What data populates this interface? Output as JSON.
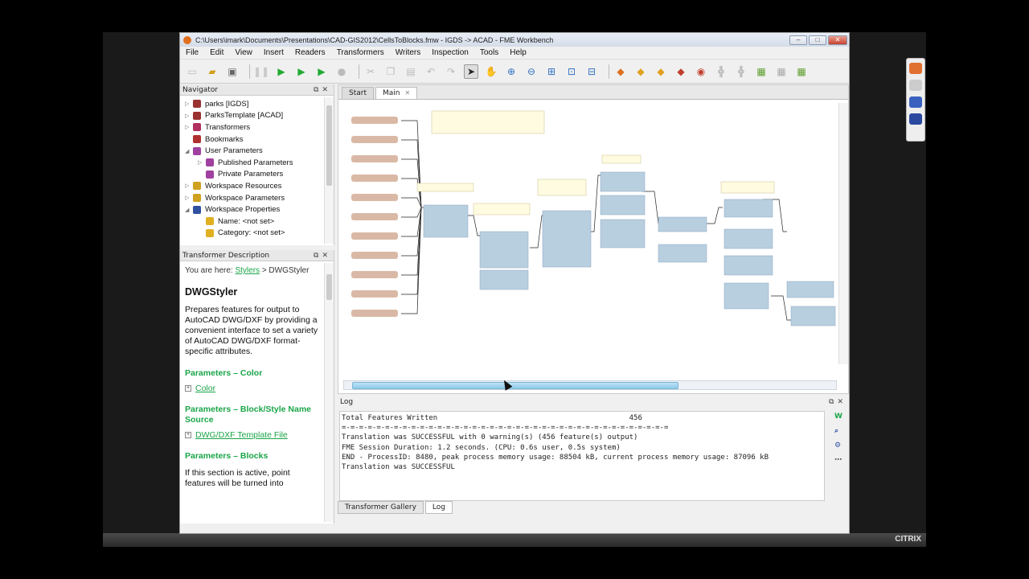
{
  "window": {
    "title": "C:\\Users\\imark\\Documents\\Presentations\\CAD-GIS2012\\CellsToBlocks.fmw - IGDS -> ACAD - FME Workbench"
  },
  "menu": [
    "File",
    "Edit",
    "View",
    "Insert",
    "Readers",
    "Transformers",
    "Writers",
    "Inspection",
    "Tools",
    "Help"
  ],
  "navigator": {
    "title": "Navigator",
    "items": [
      {
        "label": "parks [IGDS]",
        "indent": 1,
        "expand": "▷",
        "icon_color": "#9a3030"
      },
      {
        "label": "ParksTemplate [ACAD]",
        "indent": 1,
        "expand": "▷",
        "icon_color": "#9a3030"
      },
      {
        "label": "Transformers",
        "indent": 1,
        "expand": "▷",
        "icon_color": "#b03060"
      },
      {
        "label": "Bookmarks",
        "indent": 1,
        "expand": "",
        "icon_color": "#b03030"
      },
      {
        "label": "User Parameters",
        "indent": 1,
        "expand": "◢",
        "icon_color": "#a040a0"
      },
      {
        "label": "Published Parameters",
        "indent": 2,
        "expand": "▷",
        "icon_color": "#a040a0"
      },
      {
        "label": "Private Parameters",
        "indent": 2,
        "expand": "",
        "icon_color": "#a040a0"
      },
      {
        "label": "Workspace Resources",
        "indent": 1,
        "expand": "▷",
        "icon_color": "#d0a020"
      },
      {
        "label": "Workspace Parameters",
        "indent": 1,
        "expand": "▷",
        "icon_color": "#d0a020"
      },
      {
        "label": "Workspace Properties",
        "indent": 1,
        "expand": "◢",
        "icon_color": "#3050a0"
      },
      {
        "label": "Name: <not set>",
        "indent": 2,
        "expand": "",
        "icon_color": "#e0b020"
      },
      {
        "label": "Category: <not set>",
        "indent": 2,
        "expand": "",
        "icon_color": "#e0b020"
      }
    ]
  },
  "description": {
    "title": "Transformer Description",
    "here_prefix": "You are here:",
    "here_link": "Stylers",
    "here_suffix": "> DWGStyler",
    "heading": "DWGStyler",
    "text": "Prepares features for output to AutoCAD DWG/DXF by providing a convenient interface to set a variety of AutoCAD DWG/DXF format-specific attributes.",
    "sections": [
      {
        "head": "Parameters – Color",
        "link": "Color"
      },
      {
        "head": "Parameters – Block/Style Name Source",
        "link": "DWG/DXF Template File"
      },
      {
        "head": "Parameters – Blocks",
        "link": ""
      }
    ],
    "tail": "If this section is active, point features will be turned into"
  },
  "canvas": {
    "tabs": [
      {
        "label": "Start",
        "active": false
      },
      {
        "label": "Main",
        "active": true
      }
    ]
  },
  "log": {
    "title": "Log",
    "lines": [
      "Total Features Written                                            456",
      "=-=-=-=-=-=-=-=-=-=-=-=-=-=-=-=-=-=-=-=-=-=-=-=-=-=-=-=-=-=-=-=-=-=-=-=-=-=",
      "Translation was SUCCESSFUL with 0 warning(s) (456 feature(s) output)",
      "FME Session Duration: 1.2 seconds. (CPU: 0.6s user, 0.5s system)",
      "END - ProcessID: 8480, peak process memory usage: 88504 kB, current process memory usage: 87096 kB",
      "Translation was SUCCESSFUL"
    ],
    "bottom_tabs": [
      {
        "label": "Transformer Gallery",
        "active": false
      },
      {
        "label": "Log",
        "active": true
      }
    ]
  },
  "citrix": "CITRIX"
}
